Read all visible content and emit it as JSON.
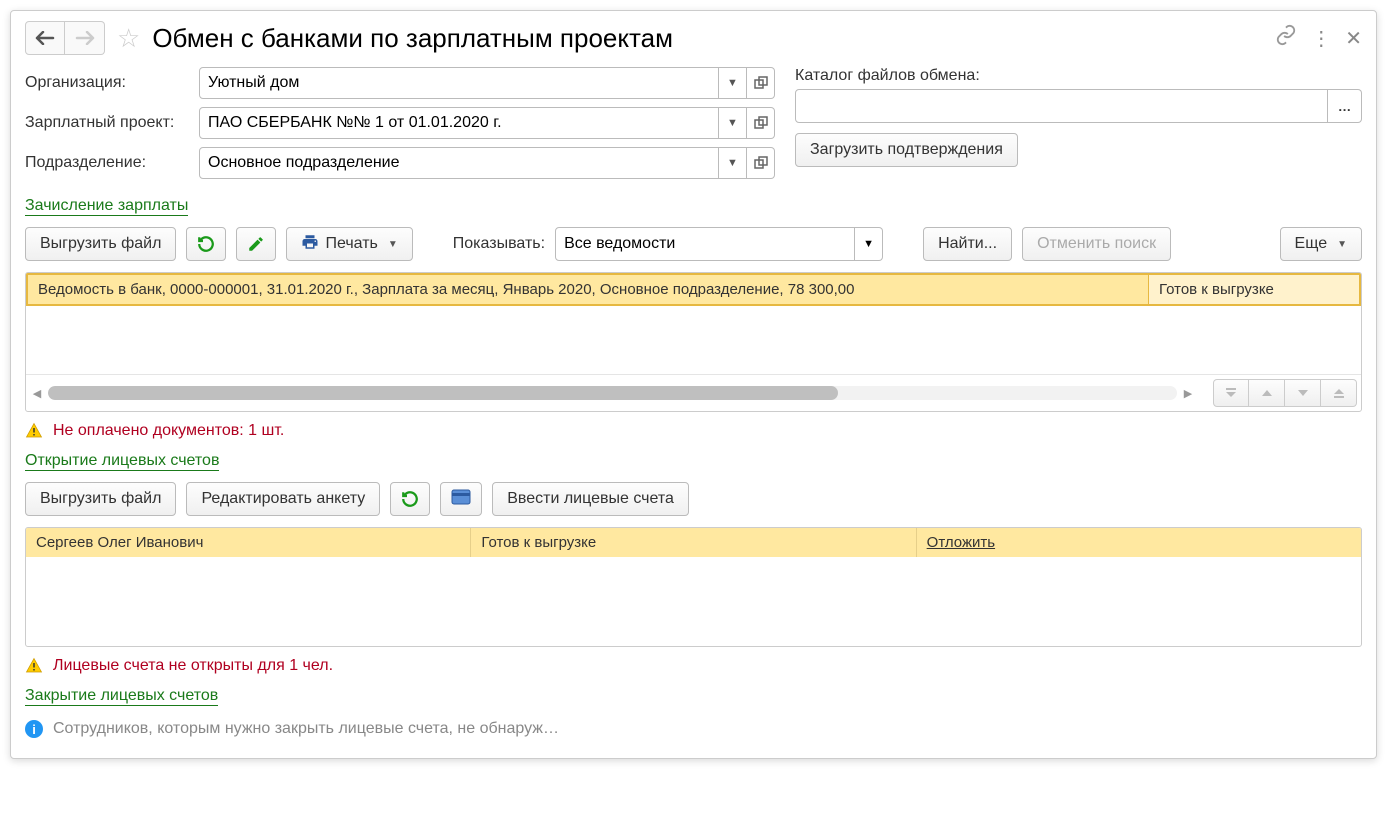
{
  "header": {
    "title": "Обмен с банками по зарплатным проектам"
  },
  "filters": {
    "org_label": "Организация:",
    "org_value": "Уютный дом",
    "project_label": "Зарплатный проект:",
    "project_value": "ПАО СБЕРБАНК №№ 1 от 01.01.2020 г.",
    "dept_label": "Подразделение:",
    "dept_value": "Основное подразделение",
    "catalog_label": "Каталог файлов обмена:",
    "catalog_value": "",
    "load_confirm_btn": "Загрузить подтверждения"
  },
  "section1": {
    "link": "Зачисление зарплаты",
    "export_btn": "Выгрузить файл",
    "print_btn": "Печать",
    "show_label": "Показывать:",
    "show_value": "Все ведомости",
    "find_btn": "Найти...",
    "cancel_find_btn": "Отменить поиск",
    "more_btn": "Еще",
    "row": {
      "main": "Ведомость в банк, 0000-000001, 31.01.2020 г., Зарплата за месяц, Январь 2020, Основное подразделение, 78 300,00",
      "status": "Готов к выгрузке"
    },
    "warning": "Не оплачено документов: 1 шт."
  },
  "section2": {
    "link": "Открытие лицевых счетов",
    "export_btn": "Выгрузить файл",
    "edit_btn": "Редактировать анкету",
    "enter_accounts_btn": "Ввести лицевые счета",
    "row": {
      "name": "Сергеев Олег Иванович",
      "status": "Готов к выгрузке",
      "action": "Отложить"
    },
    "warning": "Лицевые счета не открыты для 1 чел."
  },
  "section3": {
    "link": "Закрытие лицевых счетов",
    "info": "Сотрудников, которым нужно закрыть лицевые счета, не обнаруж…"
  }
}
